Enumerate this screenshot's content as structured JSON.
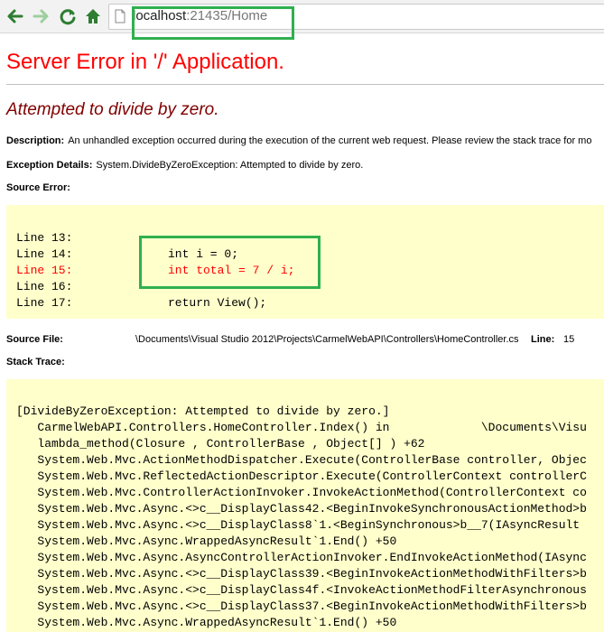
{
  "browser": {
    "url_host": "localhost",
    "url_port_path": ":21435/Home",
    "accent_color": "#2fb04e"
  },
  "error": {
    "title": "Server Error in '/' Application.",
    "message": "Attempted to divide by zero.",
    "description_label": "Description:",
    "description_text": "An unhandled exception occurred during the execution of the current web request. Please review the stack trace for mo",
    "exception_label": "Exception Details:",
    "exception_text": "System.DivideByZeroException: Attempted to divide by zero.",
    "source_error_label": "Source Error:",
    "source_lines": [
      {
        "label": "Line 13:",
        "code": "",
        "highlight": false
      },
      {
        "label": "Line 14:",
        "code": "int i = 0;",
        "highlight": false
      },
      {
        "label": "Line 15:",
        "code": "int total = 7 / i;",
        "highlight": true
      },
      {
        "label": "Line 16:",
        "code": "",
        "highlight": false
      },
      {
        "label": "Line 17:",
        "code": "return View();",
        "highlight": false
      }
    ],
    "source_file_label": "Source File:",
    "source_file_path": "\\Documents\\Visual Studio 2012\\Projects\\CarmelWebAPI\\Controllers\\HomeController.cs",
    "line_label": "Line:",
    "line_number": "15",
    "stack_trace_label": "Stack Trace:",
    "stack_trace": [
      "[DivideByZeroException: Attempted to divide by zero.]",
      "   CarmelWebAPI.Controllers.HomeController.Index() in             \\Documents\\Visu",
      "   lambda_method(Closure , ControllerBase , Object[] ) +62",
      "   System.Web.Mvc.ActionMethodDispatcher.Execute(ControllerBase controller, Objec",
      "   System.Web.Mvc.ReflectedActionDescriptor.Execute(ControllerContext controllerC",
      "   System.Web.Mvc.ControllerActionInvoker.InvokeActionMethod(ControllerContext co",
      "   System.Web.Mvc.Async.<>c__DisplayClass42.<BeginInvokeSynchronousActionMethod>b",
      "   System.Web.Mvc.Async.<>c__DisplayClass8`1.<BeginSynchronous>b__7(IAsyncResult ",
      "   System.Web.Mvc.Async.WrappedAsyncResult`1.End() +50",
      "   System.Web.Mvc.Async.AsyncControllerActionInvoker.EndInvokeActionMethod(IAsync",
      "   System.Web.Mvc.Async.<>c__DisplayClass39.<BeginInvokeActionMethodWithFilters>b",
      "   System.Web.Mvc.Async.<>c__DisplayClass4f.<InvokeActionMethodFilterAsynchronous",
      "   System.Web.Mvc.Async.<>c__DisplayClass37.<BeginInvokeActionMethodWithFilters>b",
      "   System.Web.Mvc.Async.WrappedAsyncResult`1.End() +50"
    ]
  }
}
